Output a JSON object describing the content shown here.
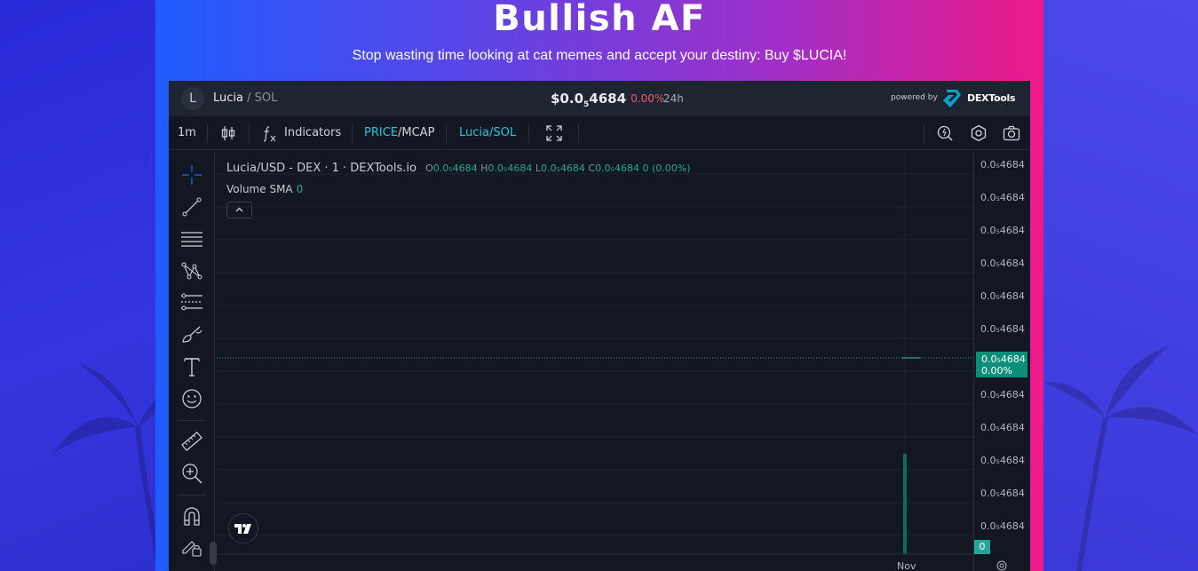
{
  "page": {
    "title": "Bullish AF",
    "subtitle": "Stop wasting time looking at cat memes and accept your destiny: Buy $LUCIA!"
  },
  "widget": {
    "pair": {
      "avatar_letter": "L",
      "base": "Lucia",
      "quote": "/ SOL"
    },
    "price": {
      "prefix": "$0.0",
      "subscript": "5",
      "digits": "4684"
    },
    "change": "- 0.00%",
    "period": "24h",
    "powered_by": "powered by",
    "brand": "DEXTools"
  },
  "toolbar": {
    "interval": "1m",
    "indicators_label": "Indicators",
    "price_label": "PRICE",
    "slash": "/",
    "mcap_label": "MCAP",
    "pair_toggle": "Lucia/SOL"
  },
  "chart": {
    "legend_title": "Lucia/USD - DEX · 1 · DEXTools.io",
    "ohlc": {
      "o_label": "O",
      "o": "0.0₅4684",
      "h_label": "H",
      "h": "0.0₅4684",
      "l_label": "L",
      "l": "0.0₅4684",
      "c_label": "C",
      "c": "0.0₅4684",
      "change": "0 (0.00%)"
    },
    "volume_label": "Volume SMA",
    "volume_value": "0",
    "time_label": "Nov"
  },
  "chart_data": {
    "type": "line",
    "title": "Lucia/USD - DEX · 1 · DEXTools.io",
    "y_tick_labels": [
      "0.0₅4684",
      "0.0₅4684",
      "0.0₅4684",
      "0.0₅4684",
      "0.0₅4684",
      "0.0₅4684",
      "0.0₅4684",
      "0.0₅4684",
      "0.0₅4684",
      "0.0₅4684",
      "0.0₅4684"
    ],
    "x_tick_labels": [
      "Nov"
    ],
    "current_price_label": "0.0₅4684",
    "current_change_label": "0.00%",
    "volume_label": "0",
    "grid": true
  },
  "colors": {
    "accent_cyan": "#26c6da",
    "up_green": "#26a69a",
    "down_red": "#ef5a6f",
    "panel_gradient_start": "#1f5cff",
    "panel_gradient_end": "#ee1a88"
  }
}
